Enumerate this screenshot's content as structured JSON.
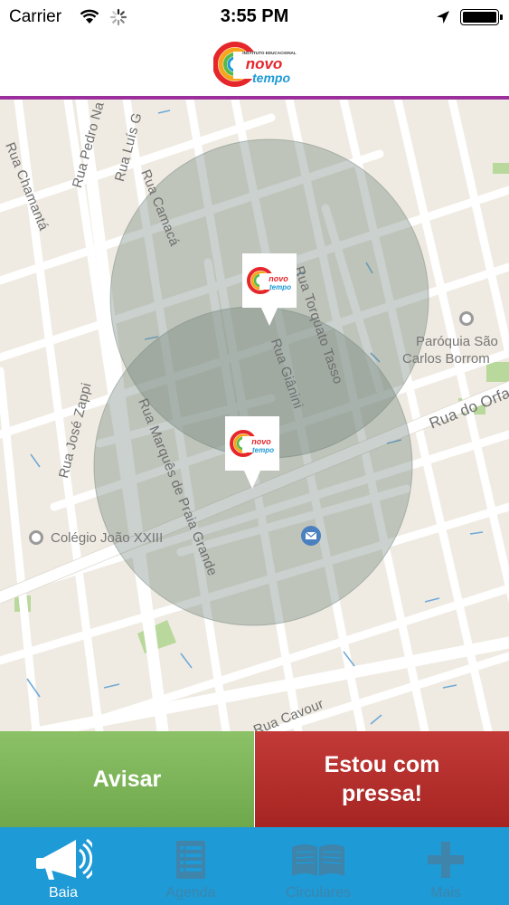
{
  "status_bar": {
    "carrier": "Carrier",
    "time": "3:55 PM",
    "battery_level": 1.0
  },
  "header": {
    "logo": {
      "top_text": "INSTITUTO EDUCACIONAL",
      "line1": "novo",
      "line2": "tempo"
    }
  },
  "map": {
    "streets": [
      "Rua Pedro Na",
      "Rua Luís G",
      "Rua Chamantá",
      "Rua Camacá",
      "Rua Torquato Tasso",
      "Rua Giânini",
      "Rua do Orfa",
      "Rua José Zappi",
      "Rua Marquês de Praia Grande",
      "Rua Cavour"
    ],
    "places": {
      "church_line1": "Paróquia São",
      "church_line2": "Carlos Borrom",
      "school": "Colégio João XXIII"
    },
    "pins": [
      {
        "name": "pin-novo-tempo-1",
        "brand": "novo tempo"
      },
      {
        "name": "pin-novo-tempo-2",
        "brand": "novo tempo"
      }
    ]
  },
  "actions": {
    "avisar": "Avisar",
    "pressa_line1": "Estou com",
    "pressa_line2": "pressa!"
  },
  "tabs": [
    {
      "label": "Baia",
      "icon": "megaphone-icon",
      "active": true
    },
    {
      "label": "Agenda",
      "icon": "agenda-list-icon",
      "active": false
    },
    {
      "label": "Circulares",
      "icon": "open-book-icon",
      "active": false
    },
    {
      "label": "Mais",
      "icon": "plus-icon",
      "active": false
    }
  ],
  "colors": {
    "header_border": "#9b2f9b",
    "avisar_green": "#7cb35a",
    "pressa_red": "#b32e2c",
    "tabbar_blue": "#1e9ad6",
    "tab_inactive": "#3e84ab",
    "map_background": "#efebe2",
    "geofence_fill": "#64786e"
  }
}
